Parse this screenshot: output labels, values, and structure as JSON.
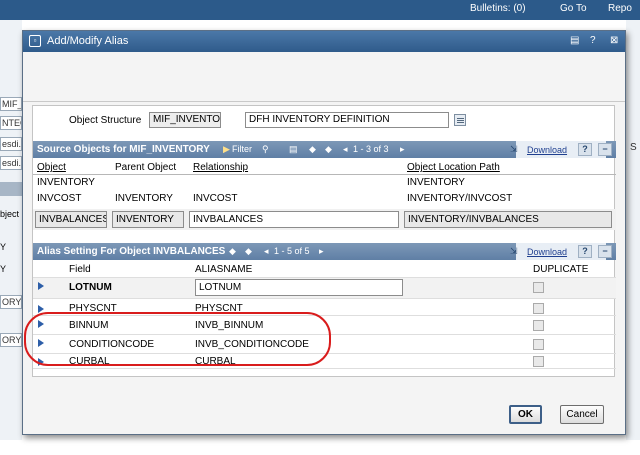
{
  "background": {
    "topbar": {
      "bulletins": "Bulletins: (0)",
      "goto": "Go To",
      "reports": "Repo"
    },
    "left_stubs": [
      "MIF_",
      "NTEG",
      "esdi.i",
      "esdi.i",
      "bject",
      "Y",
      "Y",
      "ORY",
      "ORY"
    ],
    "right_stub": "S"
  },
  "dialog": {
    "title": "Add/Modify Alias",
    "title_buttons": [
      "▤",
      "?",
      "⊠"
    ]
  },
  "object_structure": {
    "label": "Object Structure",
    "value": "MIF_INVENTORY",
    "description": "DFH INVENTORY DEFINITION"
  },
  "source_objects": {
    "title": "Source Objects for MIF_INVENTORY",
    "filter_label": "Filter",
    "pager": "1 - 3 of 3",
    "download_label": "Download",
    "columns": [
      "Object",
      "Parent Object",
      "Relationship",
      "Object Location Path"
    ],
    "rows": [
      {
        "object": "INVENTORY",
        "parent": "",
        "relationship": "",
        "path": "INVENTORY"
      },
      {
        "object": "INVCOST",
        "parent": "INVENTORY",
        "relationship": "INVCOST",
        "path": "INVENTORY/INVCOST"
      },
      {
        "object": "INVBALANCES",
        "parent": "INVENTORY",
        "relationship": "INVBALANCES",
        "path": "INVENTORY/INVBALANCES"
      }
    ]
  },
  "alias_setting": {
    "title": "Alias Setting For Object INVBALANCES",
    "pager": "1 - 5 of 5",
    "download_label": "Download",
    "columns": [
      "Field",
      "ALIASNAME",
      "DUPLICATE"
    ],
    "rows": [
      {
        "field": "LOTNUM",
        "alias": "LOTNUM"
      },
      {
        "field": "PHYSCNT",
        "alias": "PHYSCNT"
      },
      {
        "field": "BINNUM",
        "alias": "INVB_BINNUM"
      },
      {
        "field": "CONDITIONCODE",
        "alias": "INVB_CONDITIONCODE"
      },
      {
        "field": "CURBAL",
        "alias": "CURBAL"
      }
    ]
  },
  "buttons": {
    "ok": "OK",
    "cancel": "Cancel"
  },
  "icons": [
    "dialog-icon",
    "lookup-icon",
    "filter-icon",
    "row-arrow-icon",
    "download-icon",
    "help-icon",
    "collapse-icon"
  ]
}
